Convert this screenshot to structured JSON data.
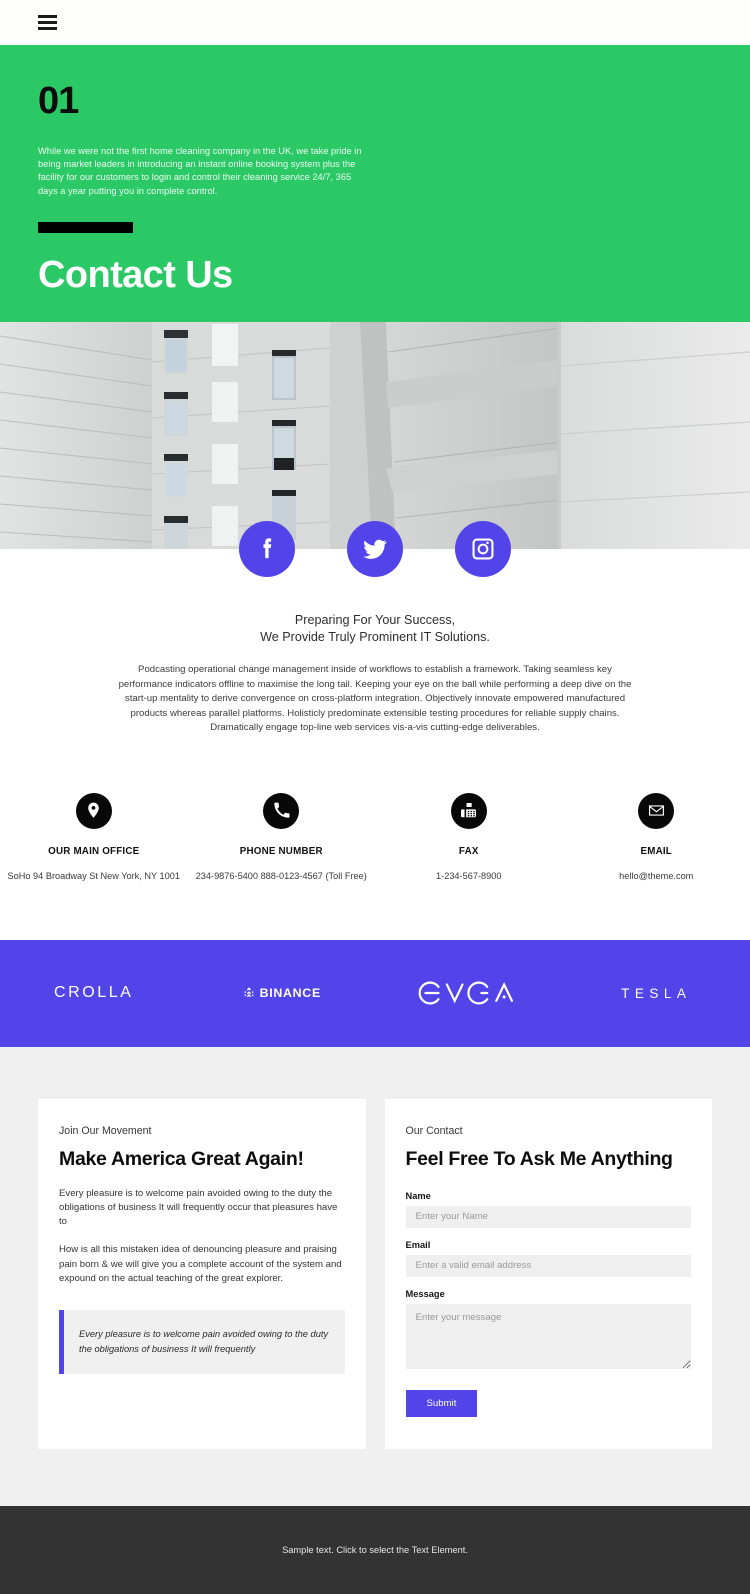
{
  "nav": {
    "menu_icon": "hamburger-menu-icon"
  },
  "hero": {
    "number": "01",
    "paragraph": "While we were not the first home cleaning company in the UK, we take pride in being market leaders in introducing an instant online booking system plus the facility for our customers to login and control their cleaning service 24/7, 365 days a year putting you in complete control.",
    "title": "Contact Us",
    "background_color": "#2bc966"
  },
  "social": {
    "accent_color": "#5244e8",
    "items": [
      {
        "name": "facebook-icon",
        "label": "Facebook"
      },
      {
        "name": "twitter-icon",
        "label": "Twitter"
      },
      {
        "name": "instagram-icon",
        "label": "Instagram"
      }
    ]
  },
  "intro": {
    "heading_line1": "Preparing For Your Success,",
    "heading_line2": "We Provide Truly Prominent IT Solutions.",
    "body": "Podcasting operational change management inside of workflows to establish a framework. Taking seamless key performance indicators offline to maximise the long tail. Keeping your eye on the ball while performing a deep dive on the start-up mentality to derive convergence on cross-platform integration. Objectively innovate empowered manufactured products whereas parallel platforms. Holisticly predominate extensible testing procedures for reliable supply chains. Dramatically engage top-line web services vis-a-vis cutting-edge deliverables."
  },
  "contact_info": [
    {
      "icon": "location-pin-icon",
      "label": "OUR MAIN OFFICE",
      "value": "SoHo 94 Broadway St New York, NY 1001"
    },
    {
      "icon": "phone-icon",
      "label": "PHONE NUMBER",
      "value": "234-9876-5400 888-0123-4567 (Toll Free)"
    },
    {
      "icon": "fax-icon",
      "label": "FAX",
      "value": "1-234-567-8900"
    },
    {
      "icon": "envelope-icon",
      "label": "EMAIL",
      "value": "hello@theme.com"
    }
  ],
  "brands": {
    "background_color": "#5244e8",
    "items": [
      {
        "name": "crolla-logo",
        "label": "CROLLA"
      },
      {
        "name": "binance-logo",
        "label": "BINANCE"
      },
      {
        "name": "evga-logo",
        "label": "EVGA"
      },
      {
        "name": "tesla-logo",
        "label": "TESLA"
      }
    ]
  },
  "left_card": {
    "eyebrow": "Join Our Movement",
    "title": "Make America Great Again!",
    "paragraph1": "Every pleasure is to welcome pain avoided owing to the duty the obligations of business It will frequently occur that pleasures have to",
    "paragraph2": "How is all this mistaken idea of denouncing pleasure and praising pain born & we will give you a complete account of the system and expound on the actual teaching of the great explorer.",
    "quote": "Every pleasure is to welcome pain avoided owing to the duty the obligations of business It will frequently",
    "quote_accent": "#5244e8"
  },
  "right_card": {
    "eyebrow": "Our Contact",
    "title": "Feel Free To Ask Me Anything",
    "fields": [
      {
        "label": "Name",
        "placeholder": "Enter your Name",
        "value": ""
      },
      {
        "label": "Email",
        "placeholder": "Enter a valid email address",
        "value": ""
      },
      {
        "label": "Message",
        "placeholder": "Enter your message",
        "value": ""
      }
    ],
    "submit_label": "Submit",
    "submit_color": "#5244e8"
  },
  "footer": {
    "text": "Sample text. Click to select the Text Element.",
    "background_color": "#333333"
  }
}
